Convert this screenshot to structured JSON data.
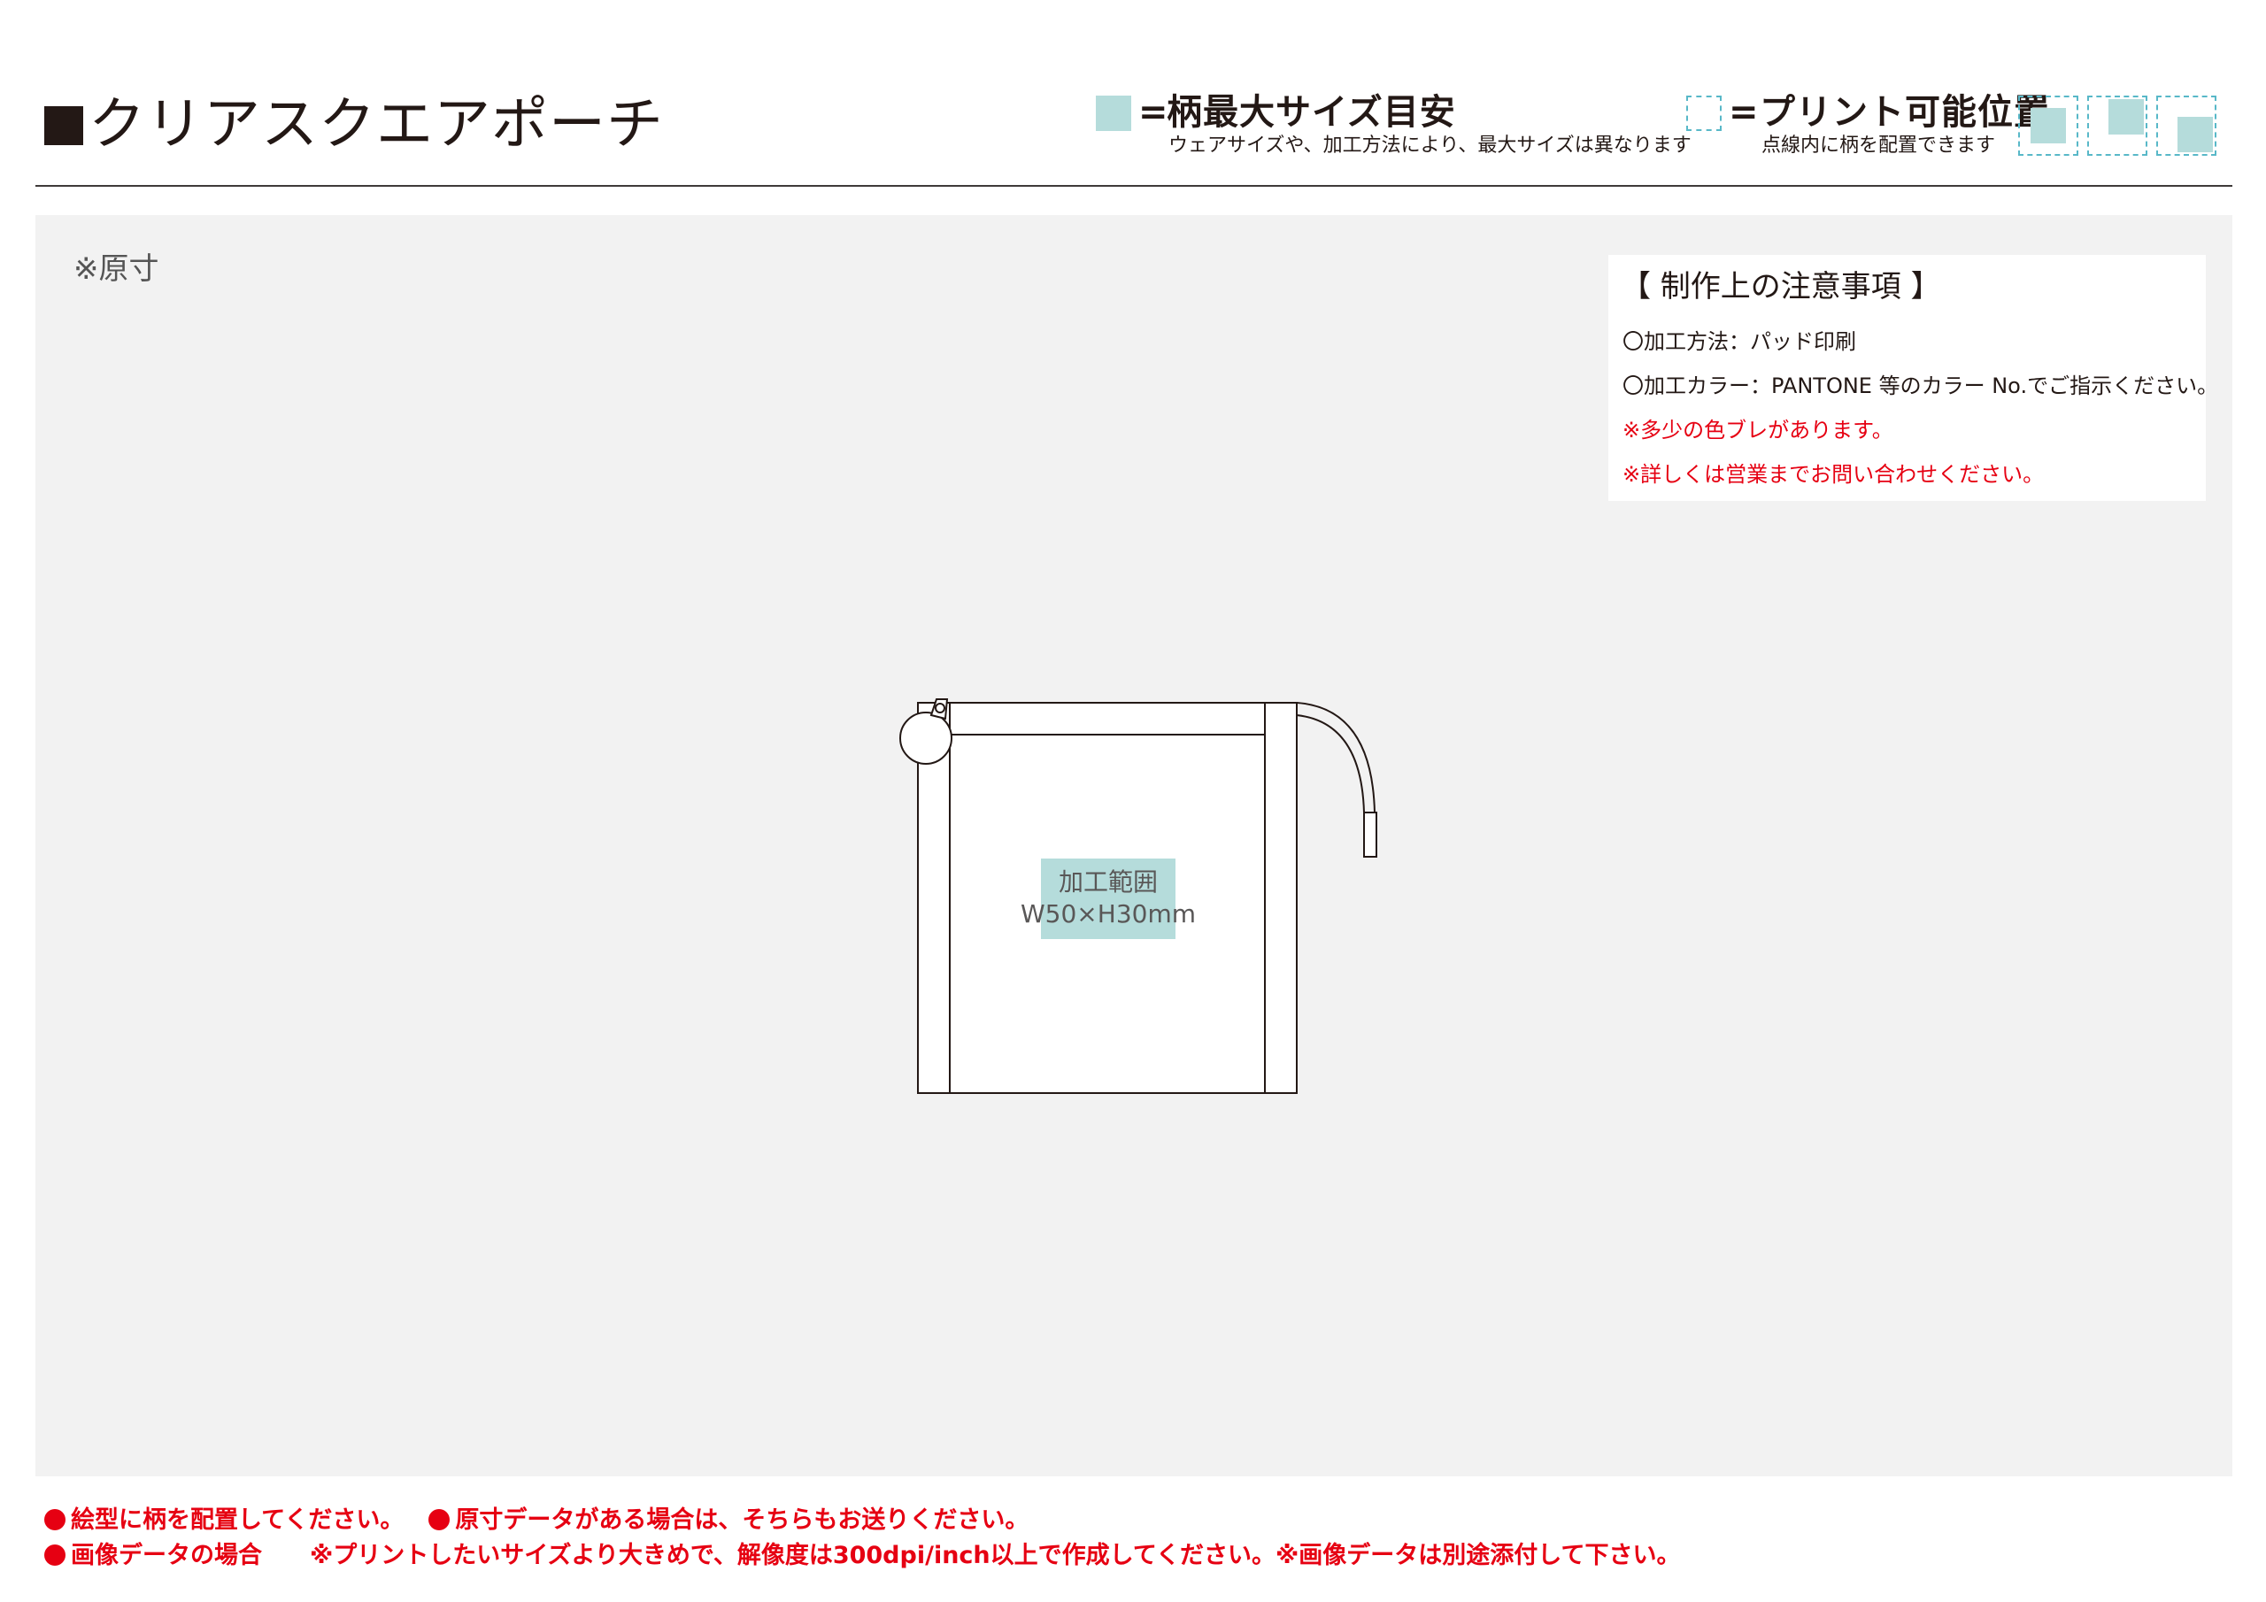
{
  "header": {
    "title": "クリアスクエアポーチ",
    "legend_max": {
      "equals": "=",
      "title": "柄最大サイズ目安",
      "note": "ウェアサイズや、加工方法により、最大サイズは異なります",
      "swatch_color": "#b5dcdb"
    },
    "legend_print": {
      "equals": "=",
      "title": "プリント可能位置",
      "note": "点線内に柄を配置できます",
      "dash_color": "#58b8c8"
    }
  },
  "canvas": {
    "scale_note": "※原寸",
    "background": "#f2f2f2"
  },
  "notes": {
    "heading": "【 制作上の注意事項 】",
    "lines": [
      "〇加工方法：パッド印刷",
      "〇加工カラー：PANTONE 等のカラー No.でご指示ください。",
      "※多少の色ブレがあります。",
      "※詳しくは営業までお問い合わせください。"
    ]
  },
  "print_area": {
    "label": "加工範囲",
    "size": "W50×H30mm",
    "color": "#b5dcdb"
  },
  "footer": {
    "line1_a": "絵型に柄を配置してください。",
    "line1_b": "原寸データがある場合は、そちらもお送りください。",
    "line2_a": "画像データの場合",
    "line2_b": "※プリントしたいサイズより大きめで、解像度は300dpi/inch以上で作成してください。※画像データは別途添付して下さい。",
    "accent": "#e60012"
  }
}
